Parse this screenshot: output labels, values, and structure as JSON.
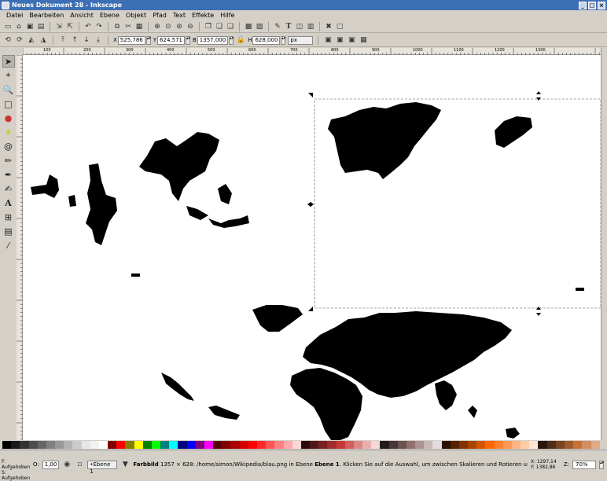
{
  "window": {
    "title": "Neues Dokument 28 - Inkscape"
  },
  "menu": [
    "Datei",
    "Bearbeiten",
    "Ansicht",
    "Ebene",
    "Objekt",
    "Pfad",
    "Text",
    "Effekte",
    "Hilfe"
  ],
  "toolbar2": {
    "x_label": "X",
    "x_value": "525,786",
    "y_label": "Y",
    "y_value": "624,571",
    "w_label": "B",
    "w_value": "1357,000",
    "h_label": "H",
    "h_value": "628,000",
    "unit": "px"
  },
  "ruler_marks": [
    "100",
    "200",
    "300",
    "400",
    "500",
    "600",
    "700",
    "800",
    "900",
    "1000",
    "1100",
    "1200",
    "1300"
  ],
  "palette": [
    "#000000",
    "#1a1a1a",
    "#333333",
    "#4d4d4d",
    "#666666",
    "#808080",
    "#999999",
    "#b3b3b3",
    "#cccccc",
    "#e6e6e6",
    "#f2f2f2",
    "#ffffff",
    "#800000",
    "#ff0000",
    "#808000",
    "#ffff00",
    "#008000",
    "#00ff00",
    "#008080",
    "#00ffff",
    "#000080",
    "#0000ff",
    "#800080",
    "#ff00ff",
    "#550000",
    "#800000",
    "#aa0000",
    "#d40000",
    "#ff0000",
    "#ff2a2a",
    "#ff5555",
    "#ff8080",
    "#ffaaaa",
    "#ffd5d5",
    "#280b0b",
    "#501616",
    "#782121",
    "#a02c2c",
    "#c83737",
    "#d35f5f",
    "#de8787",
    "#e9afaf",
    "#f4d7d7",
    "#241c1c",
    "#483737",
    "#6c5353",
    "#916f6f",
    "#ac9393",
    "#c8b7b7",
    "#e3dbdb",
    "#2b1100",
    "#552200",
    "#803300",
    "#aa4400",
    "#d45500",
    "#ff6600",
    "#ff7f2a",
    "#ff9955",
    "#ffb380",
    "#ffccaa",
    "#ffe6d5",
    "#28170b",
    "#502d16",
    "#784421",
    "#a05a2c",
    "#c87137",
    "#d38d5f",
    "#deaa87"
  ],
  "status": {
    "fill_label": "F:",
    "fill_value": "Aufgehoben",
    "stroke_label": "S:",
    "stroke_value": "Aufgehoben",
    "opacity_label": "O:",
    "opacity_value": "1,00",
    "layer": "•Ebene 1",
    "message_bold": "Farbbild",
    "message": " 1357 × 628: /home/simon/Wikipedia/blau.png in Ebene ",
    "message_layer": "Ebene 1",
    "message_end": ". Klicken Sie auf die Auswahl, um zwischen Skalieren und Rotieren umzuschalten.",
    "x_coord": "X: 1297,14",
    "y_coord": "Y: 1382,86",
    "zoom_label": "Z:",
    "zoom": "70%"
  }
}
